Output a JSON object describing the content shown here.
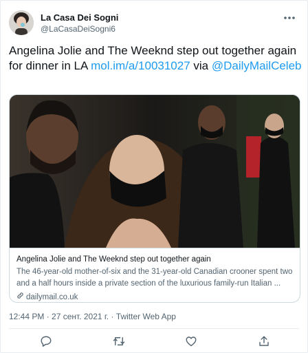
{
  "author": {
    "display_name": "La Casa Dei Sogni",
    "handle": "@LaCasaDeiSogni6",
    "avatar_icon": "profile-photo"
  },
  "tweet": {
    "text_prefix": "Angelina Jolie and The Weeknd step out together again for dinner in LA ",
    "link_text": "mol.im/a/10031027",
    "text_mid": " via ",
    "mention_text": "@DailyMailCeleb"
  },
  "card": {
    "title": "Angelina Jolie and The Weeknd step out together again",
    "description": "The 46-year-old mother-of-six and the 31-year-old Canadian crooner spent two and a half hours inside a private section of the luxurious family-run Italian ...",
    "domain": "dailymail.co.uk",
    "domain_icon": "link-icon"
  },
  "meta": {
    "timestamp": "12:44 PM · 27 сент. 2021 г. · Twitter Web App"
  },
  "actions": {
    "reply_icon": "reply-icon",
    "retweet_icon": "retweet-icon",
    "like_icon": "heart-icon",
    "share_icon": "share-icon"
  },
  "colors": {
    "link": "#1d9bf0",
    "text": "#0f1419",
    "secondary": "#536471",
    "border": "#cfd9de"
  }
}
